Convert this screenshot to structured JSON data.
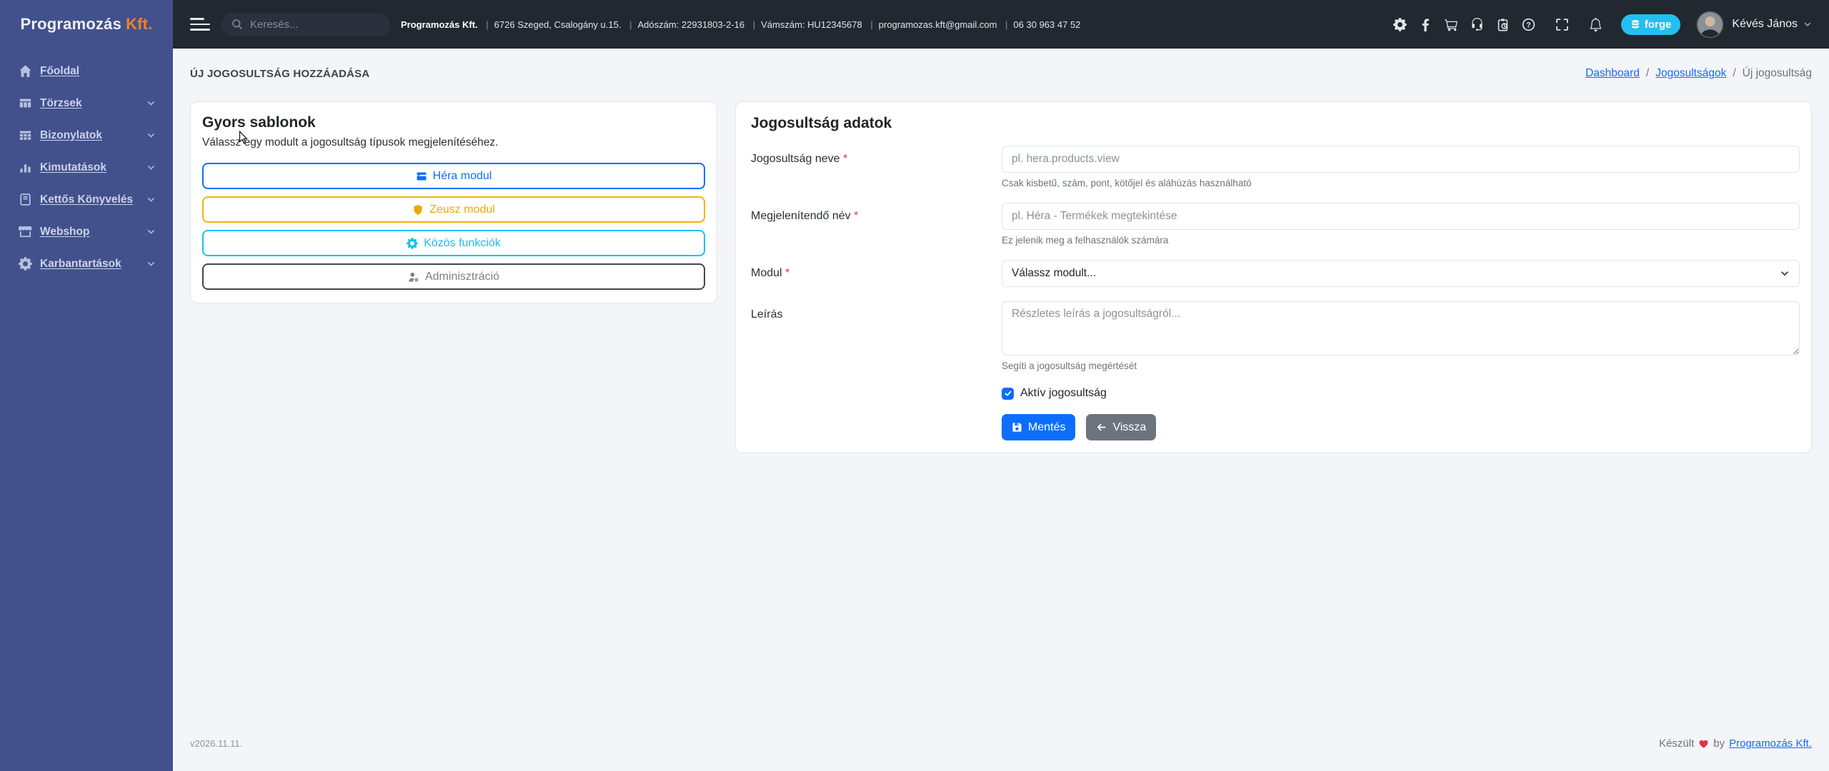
{
  "brand": {
    "name": "Programozás",
    "suffix": "Kft."
  },
  "topbar": {
    "search_placeholder": "Keresés...",
    "separator": "|",
    "company": {
      "name": "Programozás Kft.",
      "items": [
        "6726 Szeged, Csalogány u.15.",
        "Adószám: 22931803-2-16",
        "Vámszám: HU12345678",
        "programozas.kft@gmail.com",
        "06 30 963 47 52"
      ]
    },
    "icons": [
      "gear-icon",
      "facebook-icon",
      "cart-icon",
      "headset-icon",
      "clipboard-clock-icon",
      "help-icon",
      "fullscreen-icon",
      "bell-icon"
    ],
    "forge_label": "forge",
    "user_name": "Kévés János"
  },
  "sidebar": {
    "items": [
      {
        "label": "Főoldal",
        "icon": "home-icon",
        "has_submenu": false
      },
      {
        "label": "Törzsek",
        "icon": "columns-icon",
        "has_submenu": true
      },
      {
        "label": "Bizonylatok",
        "icon": "table-icon",
        "has_submenu": true
      },
      {
        "label": "Kimutatások",
        "icon": "bar-chart-icon",
        "has_submenu": true
      },
      {
        "label": "Kettős Könyvelés",
        "icon": "journal-icon",
        "has_submenu": true
      },
      {
        "label": "Webshop",
        "icon": "shop-icon",
        "has_submenu": true
      },
      {
        "label": "Karbantartások",
        "icon": "gear-icon",
        "has_submenu": true
      }
    ]
  },
  "page": {
    "title": "ÚJ JOGOSULTSÁG HOZZÁADÁSA",
    "separator": "/",
    "breadcrumb": [
      {
        "label": "Dashboard",
        "link": true
      },
      {
        "label": "Jogosultságok",
        "link": true
      },
      {
        "label": "Új jogosultság",
        "link": false
      }
    ]
  },
  "templates_card": {
    "title": "Gyors sablonok",
    "subtitle": "Válassz egy modult a jogosultság típusok megjelenítéséhez.",
    "buttons": [
      {
        "label": "Héra modul",
        "icon": "window-icon",
        "color": "#0d6efd"
      },
      {
        "label": "Zeusz modul",
        "icon": "shield-icon",
        "color": "#f5b301"
      },
      {
        "label": "Közös funkciók",
        "icon": "gear-icon",
        "color": "#17c1f0"
      },
      {
        "label": "Adminisztráció",
        "icon": "person-gear-icon",
        "color": "#43484d"
      }
    ]
  },
  "form_card": {
    "title": "Jogosultság adatok",
    "required_mark": "*",
    "fields": [
      {
        "label": "Jogosultság neve",
        "required": true,
        "type": "input",
        "placeholder": "pl. hera.products.view",
        "helper": "Csak kisbetű, szám, pont, kötőjel és aláhúzás használható"
      },
      {
        "label": "Megjelenítendő név",
        "required": true,
        "type": "input",
        "placeholder": "pl. Héra - Termékek megtekintése",
        "helper": "Ez jelenik meg a felhasználók számára"
      },
      {
        "label": "Modul",
        "required": true,
        "type": "select",
        "value": "Válassz modult..."
      },
      {
        "label": "Leírás",
        "required": false,
        "type": "textarea",
        "placeholder": "Részletes leírás a jogosultságról...",
        "helper": "Segíti a jogosultság megértését"
      }
    ],
    "checkbox": {
      "label": "Aktív jogosultság",
      "checked": true
    },
    "buttons": {
      "save": "Mentés",
      "back": "Vissza"
    }
  },
  "footer": {
    "version": "v2026.11.11.",
    "credit_prefix": "Készült",
    "credit_mid": "by",
    "credit_link": "Programozás Kft."
  },
  "colors": {
    "sidebar_bg": "#42518c",
    "topbar_bg": "#212830",
    "brand_accent": "#f58220",
    "primary": "#0d6efd",
    "warning": "#f5b301",
    "info": "#17c1f0",
    "dark": "#43484d",
    "secondary": "#6c757d",
    "forge_badge_bg": "#22c0f0",
    "danger": "#dc3545",
    "content_bg": "#f4f5f8"
  }
}
